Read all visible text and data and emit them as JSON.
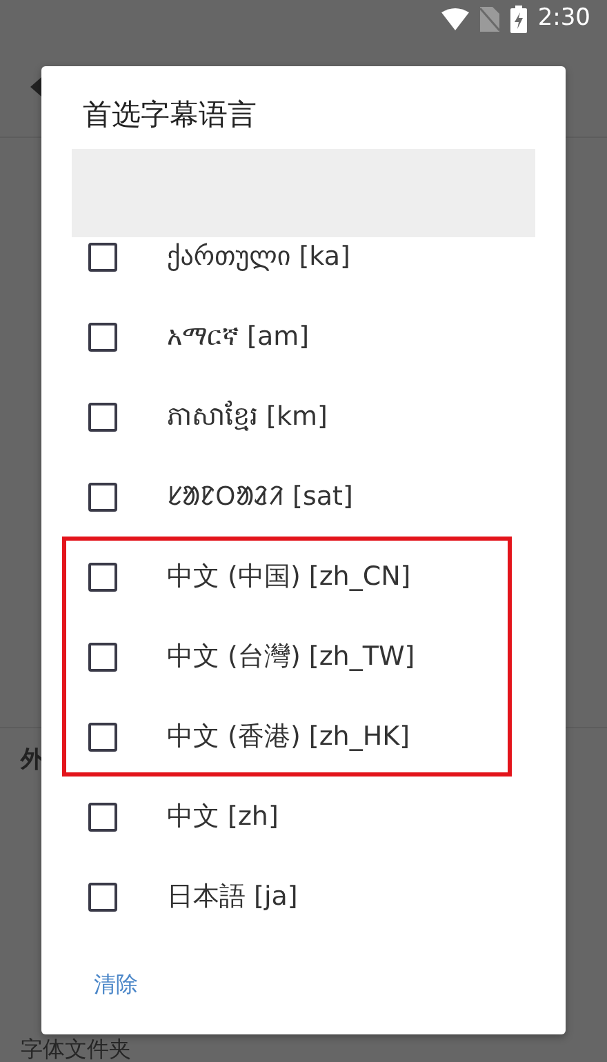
{
  "status_bar": {
    "time": "2:30"
  },
  "background": {
    "section_header": "外",
    "bottom_item": "字体文件夹"
  },
  "dialog": {
    "title": "首选字幕语言",
    "languages": [
      {
        "label": "ქართული [ka]",
        "checked": false,
        "highlighted": false
      },
      {
        "label": "አማርኛ [am]",
        "checked": false,
        "highlighted": false
      },
      {
        "label": "ភាសាខ្មែរ [km]",
        "checked": false,
        "highlighted": false
      },
      {
        "label": "ᱥᱟᱱᱛᱟᱲᱤ [sat]",
        "checked": false,
        "highlighted": false
      },
      {
        "label": "中文 (中国) [zh_CN]",
        "checked": false,
        "highlighted": true
      },
      {
        "label": "中文 (台灣) [zh_TW]",
        "checked": false,
        "highlighted": true
      },
      {
        "label": "中文 (香港) [zh_HK]",
        "checked": false,
        "highlighted": true
      },
      {
        "label": "中文 [zh]",
        "checked": false,
        "highlighted": false
      },
      {
        "label": "日本語 [ja]",
        "checked": false,
        "highlighted": false
      }
    ],
    "buttons": [
      "清除"
    ]
  }
}
